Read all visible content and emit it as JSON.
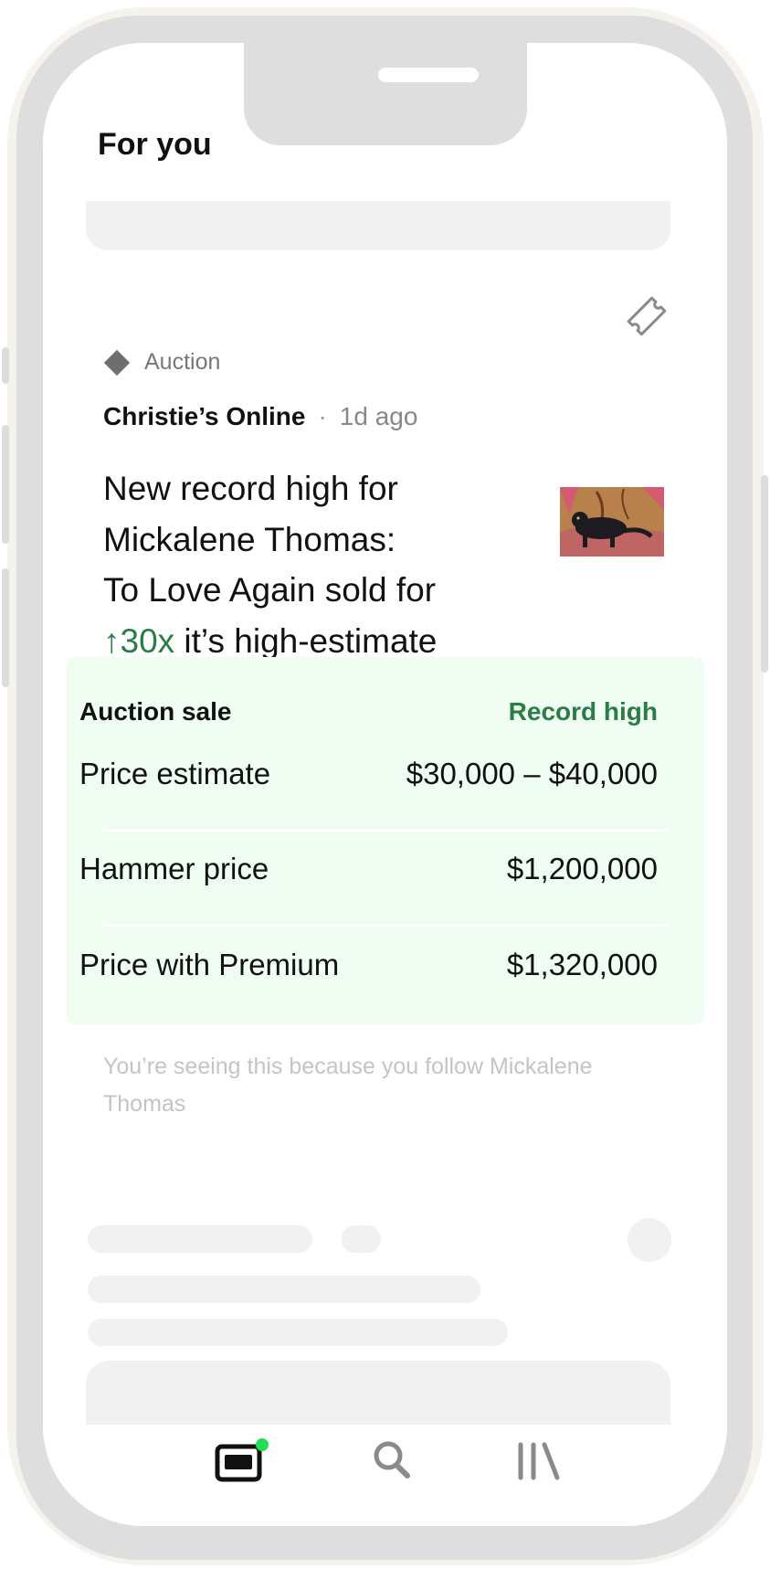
{
  "header": {
    "title": "For you"
  },
  "card": {
    "tag": "Auction",
    "source": "Christie’s Online",
    "separator": "·",
    "time": "1d ago",
    "headline_lines": [
      "New record high for",
      "Mickalene Thomas:",
      "To Love Again sold for"
    ],
    "headline_arrow": "↑",
    "headline_multiplier": "30x",
    "headline_tail": " it’s high-estimate",
    "sale": {
      "title": "Auction sale",
      "badge": "Record high",
      "rows": [
        {
          "label": "Price estimate",
          "value": "$30,000 – $40,000"
        },
        {
          "label": "Hammer price",
          "value": "$1,200,000"
        },
        {
          "label": "Price with Premium",
          "value": "$1,320,000"
        }
      ]
    },
    "reason": "You’re seeing this because you follow Mickalene Thomas"
  },
  "tabs": [
    {
      "name": "home",
      "icon": "feed-icon",
      "active": true,
      "notification": true
    },
    {
      "name": "search",
      "icon": "search-icon",
      "active": false
    },
    {
      "name": "library",
      "icon": "library-icon",
      "active": false
    }
  ],
  "colors": {
    "accent_green": "#2a7d45",
    "panel_bg": "#effdf3",
    "notification_dot": "#22dd55",
    "skeleton": "#f1f1f1"
  }
}
